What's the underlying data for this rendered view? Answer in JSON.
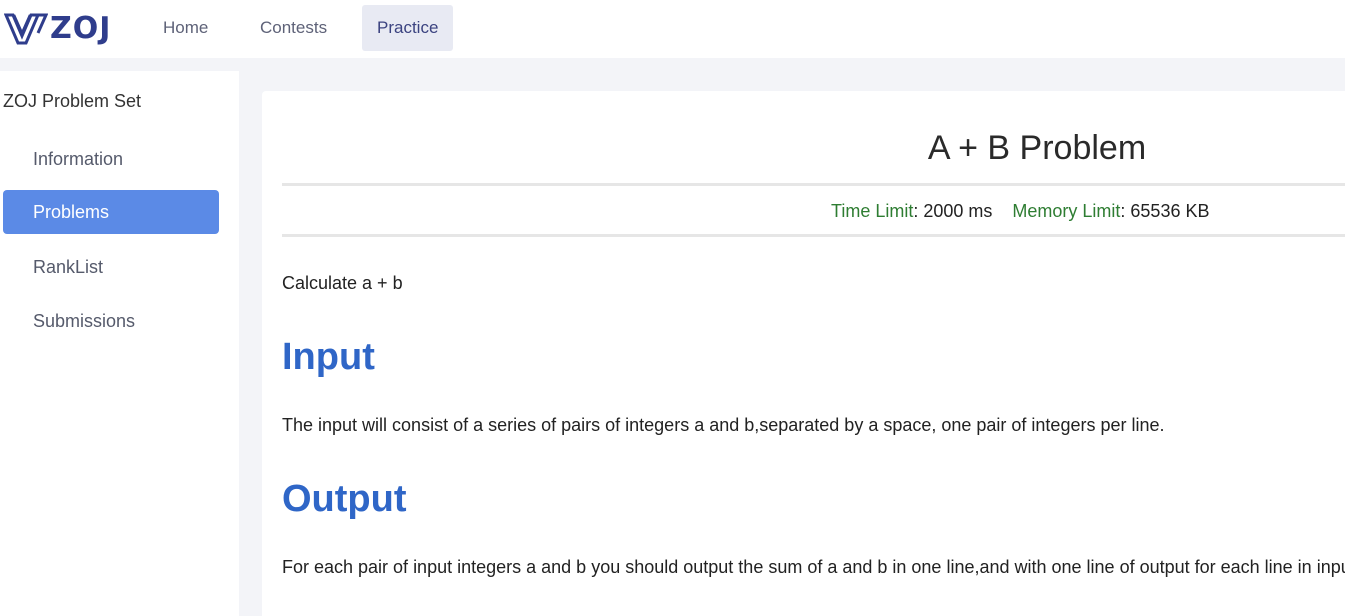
{
  "header": {
    "logo_text": "ZOJ",
    "nav": [
      {
        "label": "Home"
      },
      {
        "label": "Contests"
      },
      {
        "label": "Practice",
        "active": true
      }
    ]
  },
  "sidebar": {
    "title": "ZOJ Problem Set",
    "items": [
      {
        "label": "Information"
      },
      {
        "label": "Problems",
        "active": true
      },
      {
        "label": "RankList"
      },
      {
        "label": "Submissions"
      }
    ]
  },
  "problem": {
    "title": "A + B Problem",
    "time_limit_label": "Time Limit",
    "time_limit_value": ": 2000 ms",
    "memory_limit_label": "Memory Limit",
    "memory_limit_value": ": 65536 KB",
    "description": "Calculate a + b",
    "input_heading": "Input",
    "input_text": "The input will consist of a series of pairs of integers a and b,separated by a space, one pair of integers per line.",
    "output_heading": "Output",
    "output_text": "For each pair of input integers a and b you should output the sum of a and b in one line,and with one line of output for each line in input."
  },
  "colors": {
    "accent": "#5b8ae6",
    "heading_blue": "#2f66c7",
    "limit_green": "#2e7d32",
    "logo_navy": "#2f3d8c"
  }
}
